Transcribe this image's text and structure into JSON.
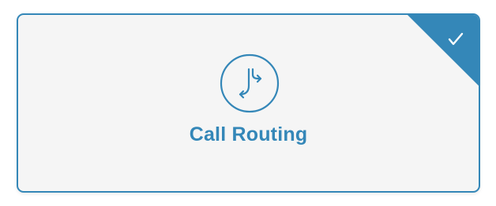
{
  "card": {
    "label": "Call Routing",
    "icon": "call-routing-icon",
    "selected": true,
    "accent_color": "#3487b8",
    "background_color": "#f5f5f5",
    "check_icon": "checkmark-icon"
  }
}
